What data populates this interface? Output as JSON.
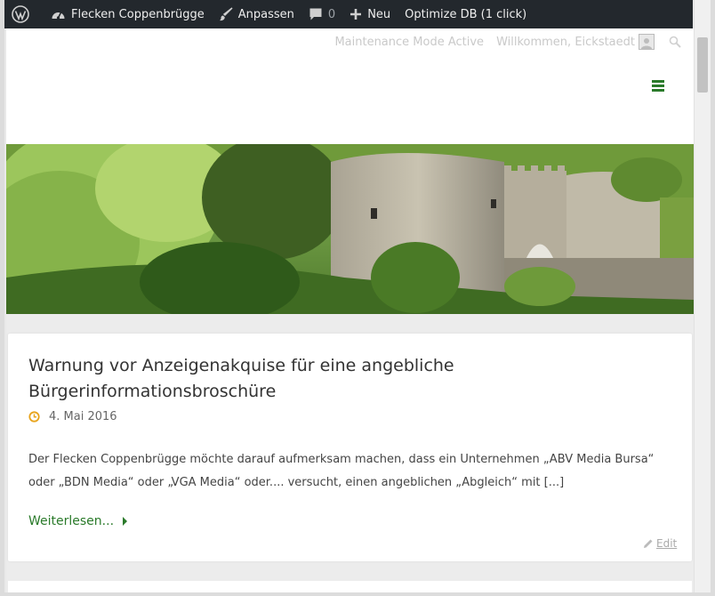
{
  "adminbar": {
    "site_name": "Flecken Coppenbrügge",
    "customize": "Anpassen",
    "comments_count": "0",
    "new": "Neu",
    "optimize": "Optimize DB (1 click)"
  },
  "topbar": {
    "maintenance": "Maintenance Mode Active",
    "welcome": "Willkommen, Eickstaedt"
  },
  "article": {
    "title": "Warnung vor Anzeigenakquise für eine angebliche Bürgerinformationsbroschüre",
    "date": "4. Mai 2016",
    "excerpt": "Der Flecken Coppenbrügge möchte darauf aufmerksam machen, dass ein Unternehmen „ABV Media Bursa“ oder „BDN Media“ oder „VGA Media“ oder.... versucht, einen angeblichen „Abgleich“ mit [...]",
    "read_more": "Weiterlesen...",
    "edit": "Edit"
  },
  "colors": {
    "adminbar_bg": "#23282d",
    "accent_green": "#2a7a2a",
    "date_icon": "#e8a41c"
  }
}
